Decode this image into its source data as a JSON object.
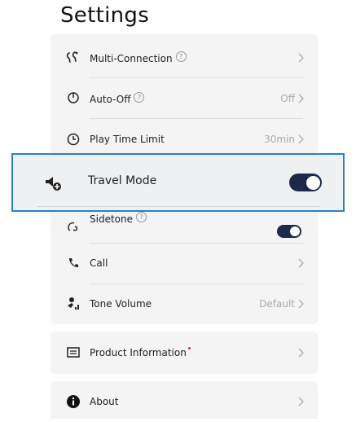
{
  "page": {
    "title": "Settings"
  },
  "settings": {
    "multi_connection": {
      "label": "Multi-Connection",
      "help": "?"
    },
    "auto_off": {
      "label": "Auto-Off",
      "help": "?",
      "value": "Off",
      "icon_caption": "Auto-Off"
    },
    "play_time_limit": {
      "label": "Play Time Limit",
      "value": "30min"
    },
    "travel_mode": {
      "label": "Travel Mode",
      "on": true
    },
    "sidetone": {
      "label": "Sidetone",
      "help": "?",
      "on": true
    },
    "call": {
      "label": "Call"
    },
    "tone_volume": {
      "label": "Tone Volume",
      "value": "Default"
    },
    "product_information": {
      "label": "Product Information",
      "badge_color": "#e0245e"
    },
    "about": {
      "label": "About"
    }
  },
  "colors": {
    "accent": "#2d80c4",
    "toggle_on": "#1c2a4a",
    "card_bg": "#f4f4f4"
  }
}
